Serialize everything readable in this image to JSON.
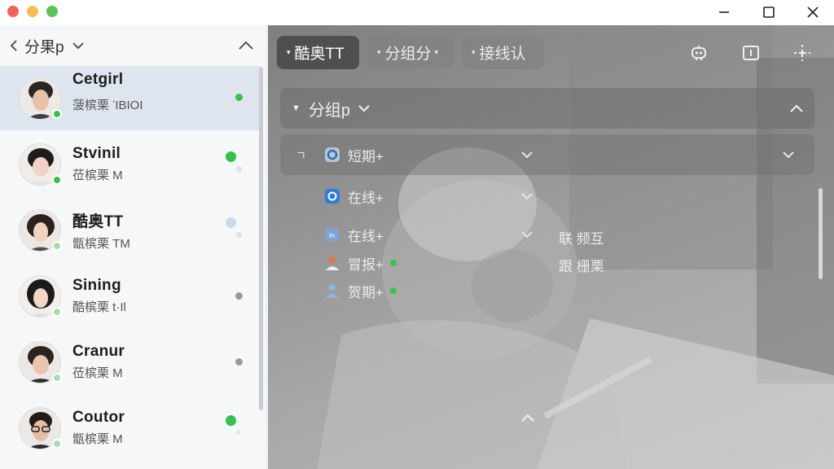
{
  "sidebar": {
    "header": {
      "title": "分果p"
    },
    "contacts": [
      {
        "name": "Cetgirl",
        "subtitle": "菠槟栗 ་ΙΒΙΟΙ",
        "presence": "online",
        "indicator": "#36c24a"
      },
      {
        "name": "Stvinil",
        "subtitle": "莅槟栗 M",
        "presence": "online",
        "indicator": "#36c24a"
      },
      {
        "name": "酷奥TT",
        "subtitle": "甑槟栗 TM",
        "presence": "away",
        "indicator": "#c9d9ec"
      },
      {
        "name": "Sining",
        "subtitle": "酷槟栗 t·Il",
        "presence": "away",
        "indicator": "#9a9a9a"
      },
      {
        "name": "Cranur",
        "subtitle": "莅槟栗 M",
        "presence": "online",
        "indicator": "#9a9a9a"
      },
      {
        "name": "Coutor",
        "subtitle": "甑槟栗 M",
        "presence": "away",
        "indicator": "#36c24a"
      }
    ]
  },
  "main": {
    "tabs": [
      {
        "label": "酷奥TT",
        "active": true
      },
      {
        "label": "分组分",
        "active": false
      },
      {
        "label": "接线认",
        "active": false
      }
    ],
    "toolbar": [
      "bot-icon",
      "panel-icon",
      "crosshair-icon"
    ],
    "group": {
      "title": "分组p"
    },
    "rows": [
      {
        "label": "短期+",
        "icon": "circle-o-icon"
      },
      {
        "label": "在线+",
        "icon": "blue-app-icon"
      },
      {
        "label": "在线+",
        "icon": "square-icon",
        "side_label": "联 频互"
      },
      {
        "label": "冒报+",
        "icon": "orange-user-icon",
        "side_label": "跟 栅栗",
        "dot": true
      },
      {
        "label": "贺期+",
        "icon": "blue-user-icon",
        "dot": true
      }
    ],
    "row_marker": "ㄱ"
  },
  "colors": {
    "online": "#36c24a",
    "active_tab": "#4f4f4f",
    "accent": "#2f7bd9"
  }
}
